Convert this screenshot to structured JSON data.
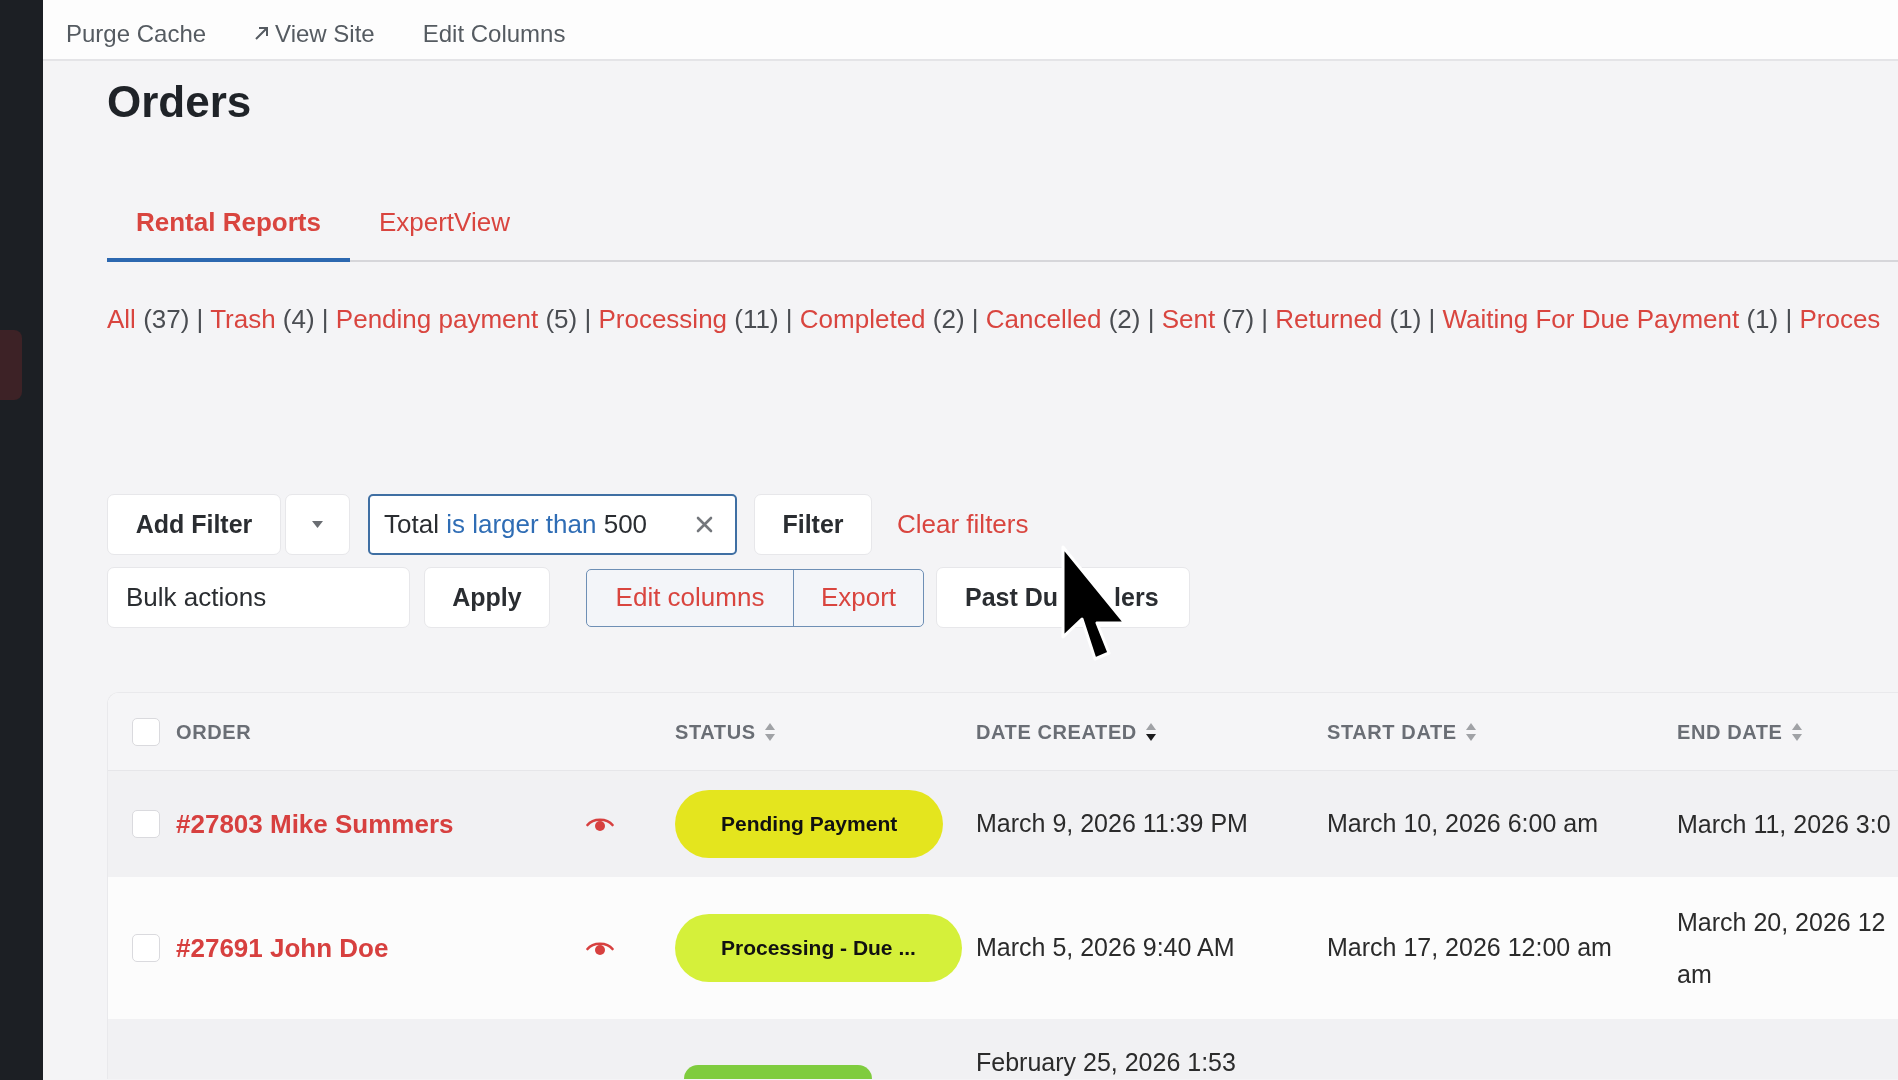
{
  "top_bar": {
    "items": [
      {
        "label": "Purge Cache",
        "kind": "link"
      },
      {
        "label": "View Site",
        "kind": "external"
      },
      {
        "label": "Edit Columns",
        "kind": "link"
      }
    ]
  },
  "page": {
    "title": "Orders"
  },
  "tabs": [
    {
      "label": "Rental Reports",
      "selected": true
    },
    {
      "label": "ExpertView",
      "selected": false
    }
  ],
  "status_filters": [
    {
      "label": "All",
      "count": "(37)",
      "separator": "|"
    },
    {
      "label": "Trash",
      "count": "(4)",
      "separator": "|"
    },
    {
      "label": "Pending payment",
      "count": "(5)",
      "separator": "|"
    },
    {
      "label": "Processing",
      "count": "(11)",
      "separator": "|"
    },
    {
      "label": "Completed",
      "count": "(2)",
      "separator": "|"
    },
    {
      "label": "Cancelled",
      "count": "(2)",
      "separator": "|"
    },
    {
      "label": "Sent",
      "count": "(7)",
      "separator": "|"
    },
    {
      "label": "Returned",
      "count": "(1)",
      "separator": "|"
    },
    {
      "label": "Waiting For Due Payment",
      "count": "(1)",
      "separator": "|"
    },
    {
      "label": "Proces"
    }
  ],
  "filter_bar": {
    "add_filter": "Add Filter",
    "active_filter": {
      "field": "Total",
      "operator": "is larger than",
      "value": "500"
    },
    "filter_button": "Filter",
    "clear_link": "Clear filters"
  },
  "action_bar": {
    "bulk_actions": {
      "value": "Bulk actions"
    },
    "apply_button": "Apply",
    "button_group": [
      "Edit columns",
      "Export"
    ],
    "preset_button": {
      "label_parts": [
        "Past Du",
        "lers"
      ]
    }
  },
  "table": {
    "select_all": {
      "checked": false
    },
    "columns": [
      {
        "label": "ORDER",
        "sortable": false
      },
      {
        "label": "STATUS",
        "sortable": true,
        "sorted_desc": false
      },
      {
        "label": "DATE CREATED",
        "sortable": true,
        "sorted_desc": true
      },
      {
        "label": "START DATE",
        "sortable": true,
        "sorted_desc": false
      },
      {
        "label": "END DATE",
        "sortable": true,
        "sorted_desc": false
      }
    ],
    "rows": [
      {
        "checked": false,
        "order": "#27803 Mike Summers",
        "status": {
          "label": "Pending Payment",
          "color": "#e4e51e"
        },
        "date_created": "March 9, 2026 11:39 PM",
        "start_date": "March 10, 2026 6:00 am",
        "end_date": [
          "March 11, 2026 3:0"
        ]
      },
      {
        "checked": false,
        "order": "#27691 John Doe",
        "status": {
          "label": "Processing - Due ...",
          "color": "#d5f03a"
        },
        "date_created": "March 5, 2026 9:40 AM",
        "start_date": "March 17, 2026 12:00 am",
        "end_date": [
          "March 20, 2026 12",
          "am"
        ]
      },
      {
        "status": {
          "color": "#7fcc3e"
        },
        "date_created": "February 25, 2026 1:53"
      }
    ]
  }
}
